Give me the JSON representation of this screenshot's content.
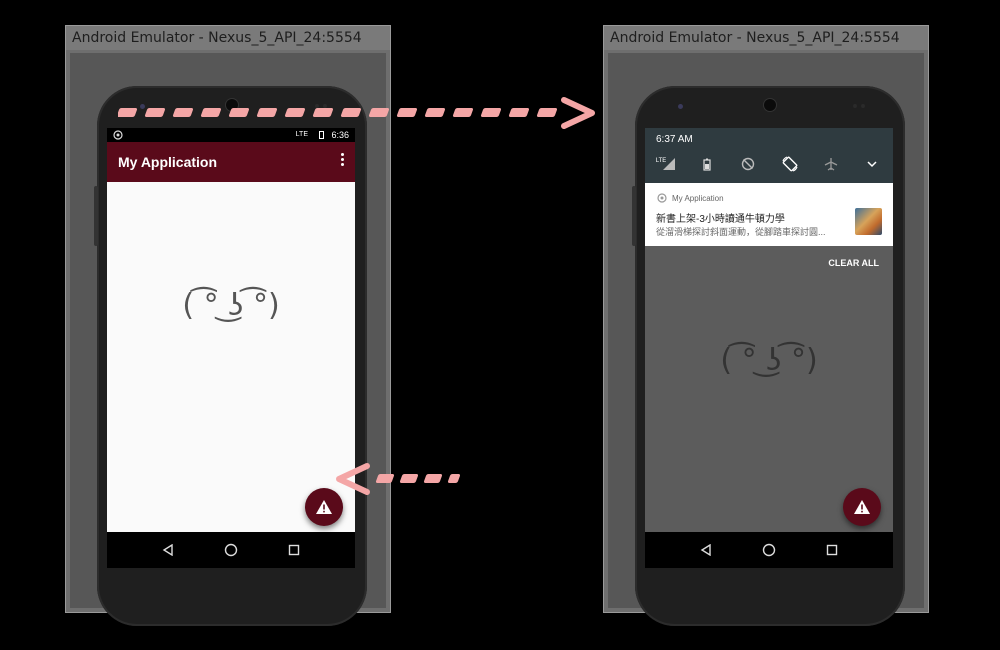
{
  "left_window": {
    "title": "Android Emulator - Nexus_5_API_24:5554",
    "status_time": "6:36",
    "status_network": "LTE",
    "app_title": "My Application",
    "face": "( ͡° ͜ʖ ͡°)"
  },
  "right_window": {
    "title": "Android Emulator - Nexus_5_API_24:5554",
    "shade_time": "6:37 AM",
    "quick_settings": [
      "lte-signal-icon",
      "battery-icon",
      "dnd-off-icon",
      "auto-rotate-icon",
      "airplane-mode-icon",
      "expand-chevron-icon"
    ],
    "qs_lte_label": "LTE",
    "notification": {
      "app_name": "My Application",
      "title": "新書上架-3小時讀通牛頓力學",
      "text": "從溜滑梯探討斜面運動，從腳踏車探討圓..."
    },
    "clear_all": "CLEAR ALL",
    "face": "( ͡° ͜ʖ ͡°)"
  },
  "colors": {
    "app_bar": "#5a0a1a",
    "fab": "#5a0a1a",
    "arrow": "#f4a6a6",
    "shade": "#2f3b40"
  },
  "icons": {
    "fab": "warning-icon",
    "nav": [
      "back-icon",
      "home-icon",
      "recents-icon"
    ]
  }
}
